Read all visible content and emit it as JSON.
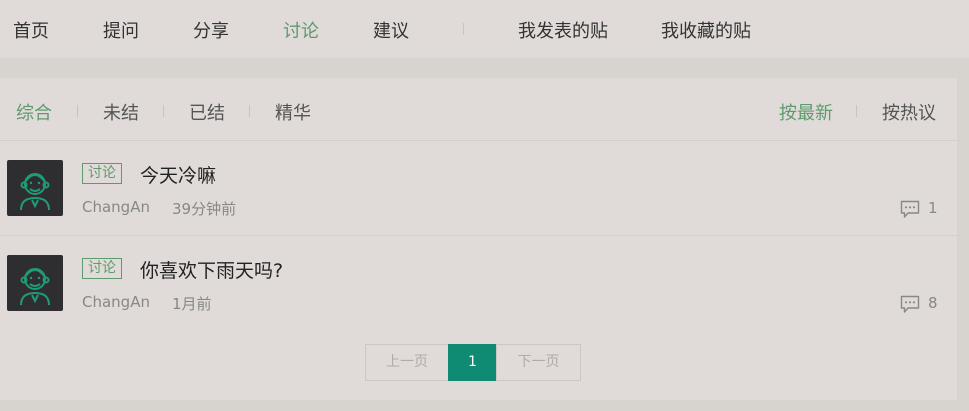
{
  "top_nav": {
    "items": [
      "首页",
      "提问",
      "分享",
      "讨论",
      "建议"
    ],
    "user_links": [
      "我发表的贴",
      "我收藏的贴"
    ],
    "active": "讨论"
  },
  "filter": {
    "items": [
      "综合",
      "未结",
      "已结",
      "精华"
    ],
    "active": "综合",
    "sort": [
      "按最新",
      "按热议"
    ],
    "sort_active": "按最新"
  },
  "posts": [
    {
      "tag": "讨论",
      "title": "今天冷嘛",
      "author": "ChangAn",
      "time": "39分钟前",
      "comments": "1"
    },
    {
      "tag": "讨论",
      "title": "你喜欢下雨天吗?",
      "author": "ChangAn",
      "time": "1月前",
      "comments": "8"
    }
  ],
  "pagination": {
    "prev": "上一页",
    "current": "1",
    "next": "下一页"
  },
  "colors": {
    "accent": "#5e9a6e",
    "page_active": "#0f8a73",
    "background": "#e0dbd8"
  }
}
